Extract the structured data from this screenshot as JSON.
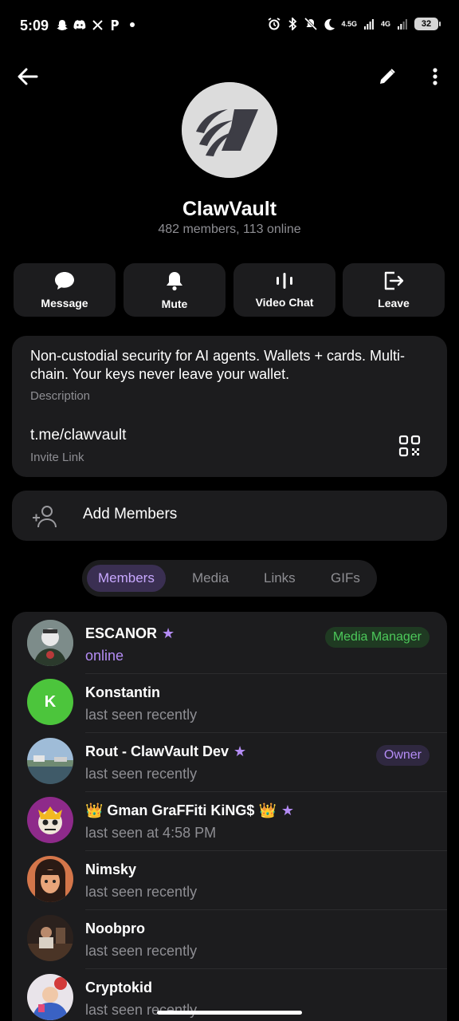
{
  "status_bar": {
    "time": "5:09",
    "left_icons": [
      "snapchat-icon",
      "discord-icon",
      "x-icon",
      "p-icon",
      "dot-icon"
    ],
    "right_icons": [
      "alarm-icon",
      "bluetooth-icon",
      "mute-icon",
      "moon-icon",
      "signal-icon",
      "signal-icon"
    ],
    "net1": "4.5G",
    "net2": "4G",
    "battery": "32"
  },
  "group": {
    "title": "ClawVault",
    "subtitle": "482 members, 113 online"
  },
  "actions": [
    {
      "label": "Message",
      "icon": "chat-bubble-icon"
    },
    {
      "label": "Mute",
      "icon": "bell-icon"
    },
    {
      "label": "Video Chat",
      "icon": "voice-bars-icon"
    },
    {
      "label": "Leave",
      "icon": "leave-icon"
    }
  ],
  "info": {
    "description": "Non-custodial security for AI agents. Wallets + cards. Multi-chain. Your keys never leave your wallet.",
    "description_label": "Description",
    "link": "t.me/clawvault",
    "link_label": "Invite Link"
  },
  "add_members": {
    "label": "Add Members"
  },
  "tabs": [
    {
      "label": "Members",
      "active": true
    },
    {
      "label": "Media",
      "active": false
    },
    {
      "label": "Links",
      "active": false
    },
    {
      "label": "GIFs",
      "active": false
    }
  ],
  "members": [
    {
      "name": "ESCANOR",
      "star": true,
      "status": "online",
      "online": true,
      "badge": "Media Manager",
      "avatar_initial": ""
    },
    {
      "name": "Konstantin",
      "star": false,
      "status": "last seen recently",
      "online": false,
      "badge": "",
      "avatar_initial": "K"
    },
    {
      "name": "Rout - ClawVault Dev",
      "star": true,
      "status": "last seen recently",
      "online": false,
      "badge": "Owner",
      "avatar_initial": ""
    },
    {
      "name": "👑 Gman GraFFiti KiNG$ 👑",
      "star": true,
      "status": "last seen at 4:58 PM",
      "online": false,
      "badge": "",
      "avatar_initial": ""
    },
    {
      "name": "Nimsky",
      "star": false,
      "status": "last seen recently",
      "online": false,
      "badge": "",
      "avatar_initial": ""
    },
    {
      "name": "Noobpro",
      "star": false,
      "status": "last seen recently",
      "online": false,
      "badge": "",
      "avatar_initial": ""
    },
    {
      "name": "Cryptokid",
      "star": false,
      "status": "last seen recently",
      "online": false,
      "badge": "",
      "avatar_initial": ""
    }
  ],
  "colors": {
    "accent": "#b48cf5",
    "background": "#000000",
    "card": "#1c1c1e",
    "admin_green": "#4cc85a"
  }
}
